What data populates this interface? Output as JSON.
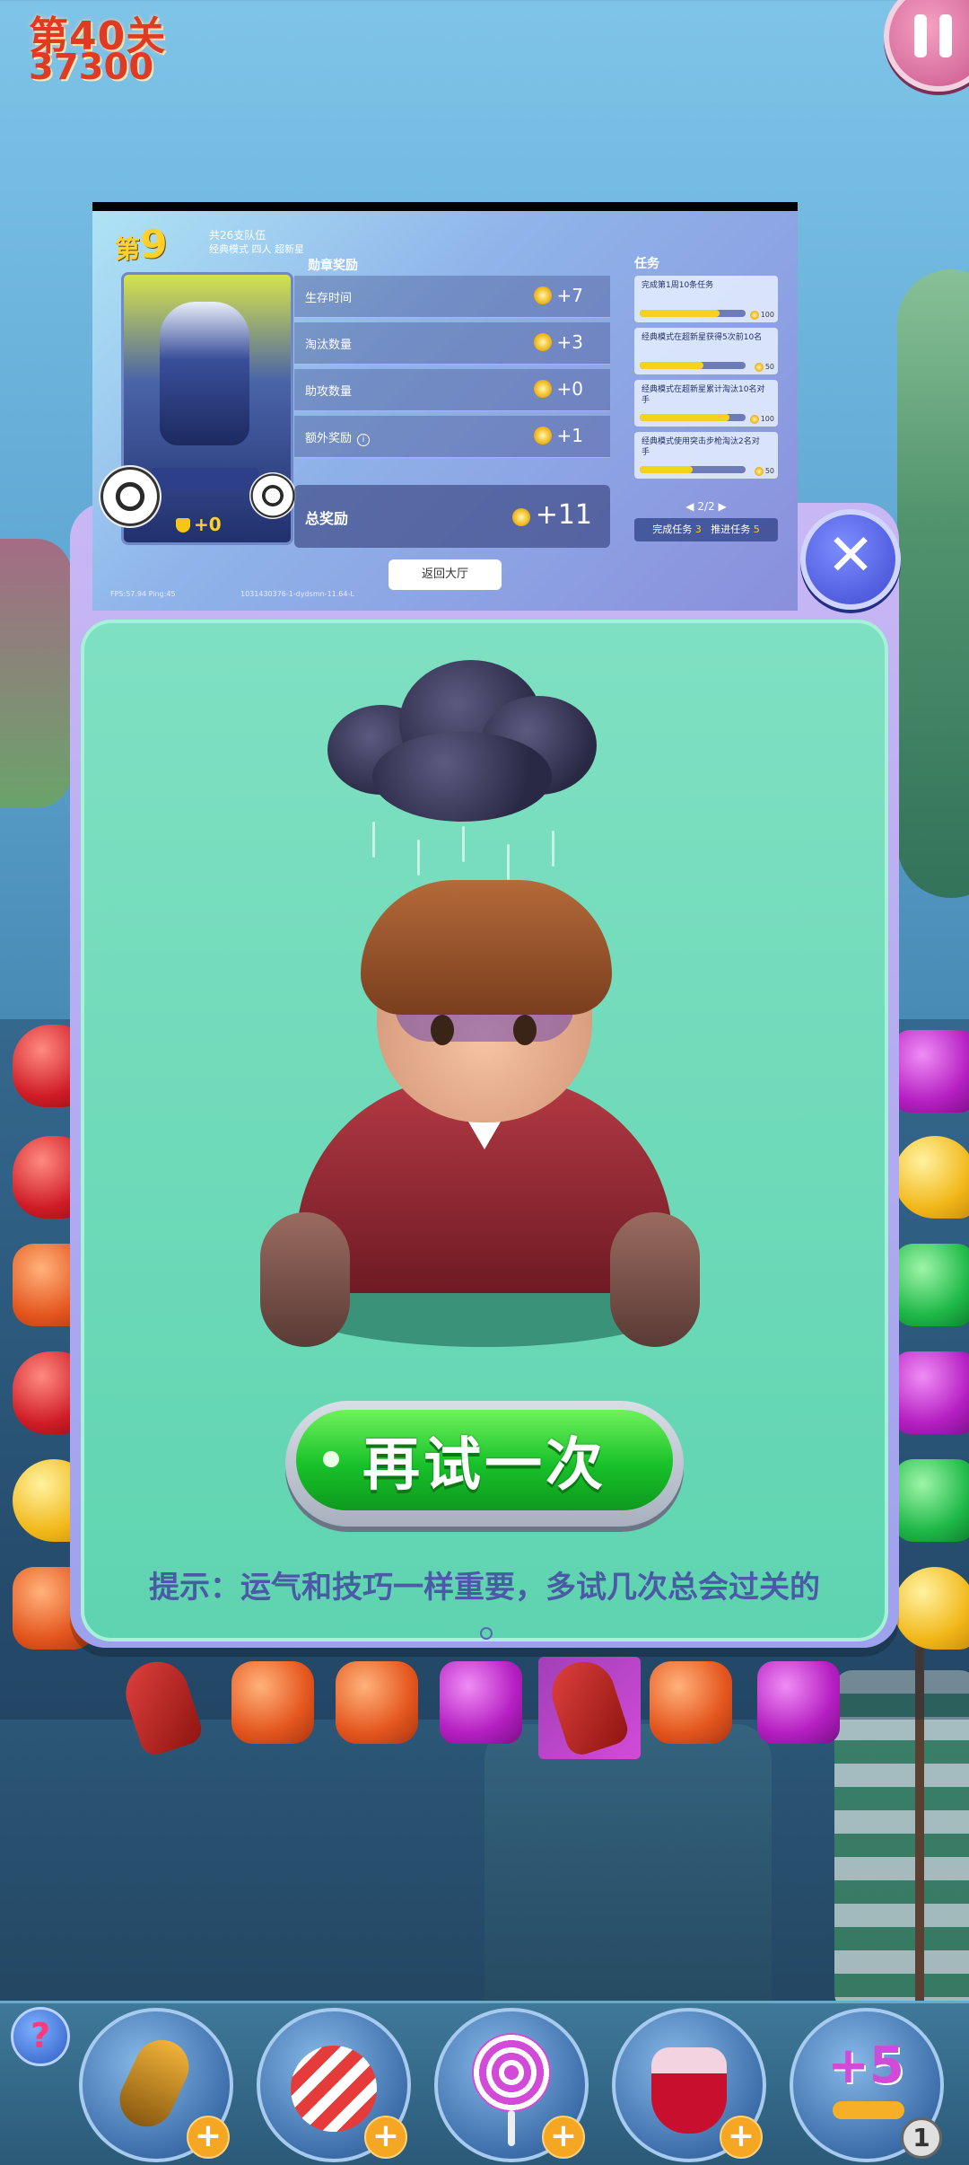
{
  "hud": {
    "level": "第40关",
    "score": "37300"
  },
  "popup": {
    "retry_label": "再试一次",
    "tip": "提示：运气和技巧一样重要，多试几次总会过关的"
  },
  "overlay": {
    "rank_prefix": "第",
    "rank_number": "9",
    "team_count": "共26支队伍",
    "mode": "经典模式 四人 超新星",
    "hero_score": "+0",
    "rewards_title": "勋章奖励",
    "rewards": [
      {
        "name": "生存时间",
        "value": "+7"
      },
      {
        "name": "淘汰数量",
        "value": "+3"
      },
      {
        "name": "助攻数量",
        "value": "+0"
      },
      {
        "name": "额外奖励",
        "value": "+1"
      }
    ],
    "total_label": "总奖励",
    "total_value": "+11",
    "tasks_title": "任务",
    "tasks": [
      {
        "text": "完成第1周10条任务",
        "progress": 0.75,
        "reward": "100"
      },
      {
        "text": "经典模式在超新星获得5次前10名",
        "progress": 0.6,
        "reward": "50"
      },
      {
        "text": "经典模式在超新星累计淘汰10名对手",
        "progress": 0.85,
        "reward": "100"
      },
      {
        "text": "经典模式使用突击步枪淘汰2名对手",
        "progress": 0.5,
        "reward": "50"
      }
    ],
    "pager": "2/2",
    "done_label": "完成任务",
    "done_count": "3",
    "push_label": "推进任务",
    "push_count": "5",
    "back_label": "返回大厅",
    "fps": "FPS:57.94 Ping:45",
    "build": "1031430376-1-dydsmn-11.64-L"
  },
  "boosters": {
    "help": "?",
    "moves_plus": "+5",
    "moves_count": "1"
  }
}
